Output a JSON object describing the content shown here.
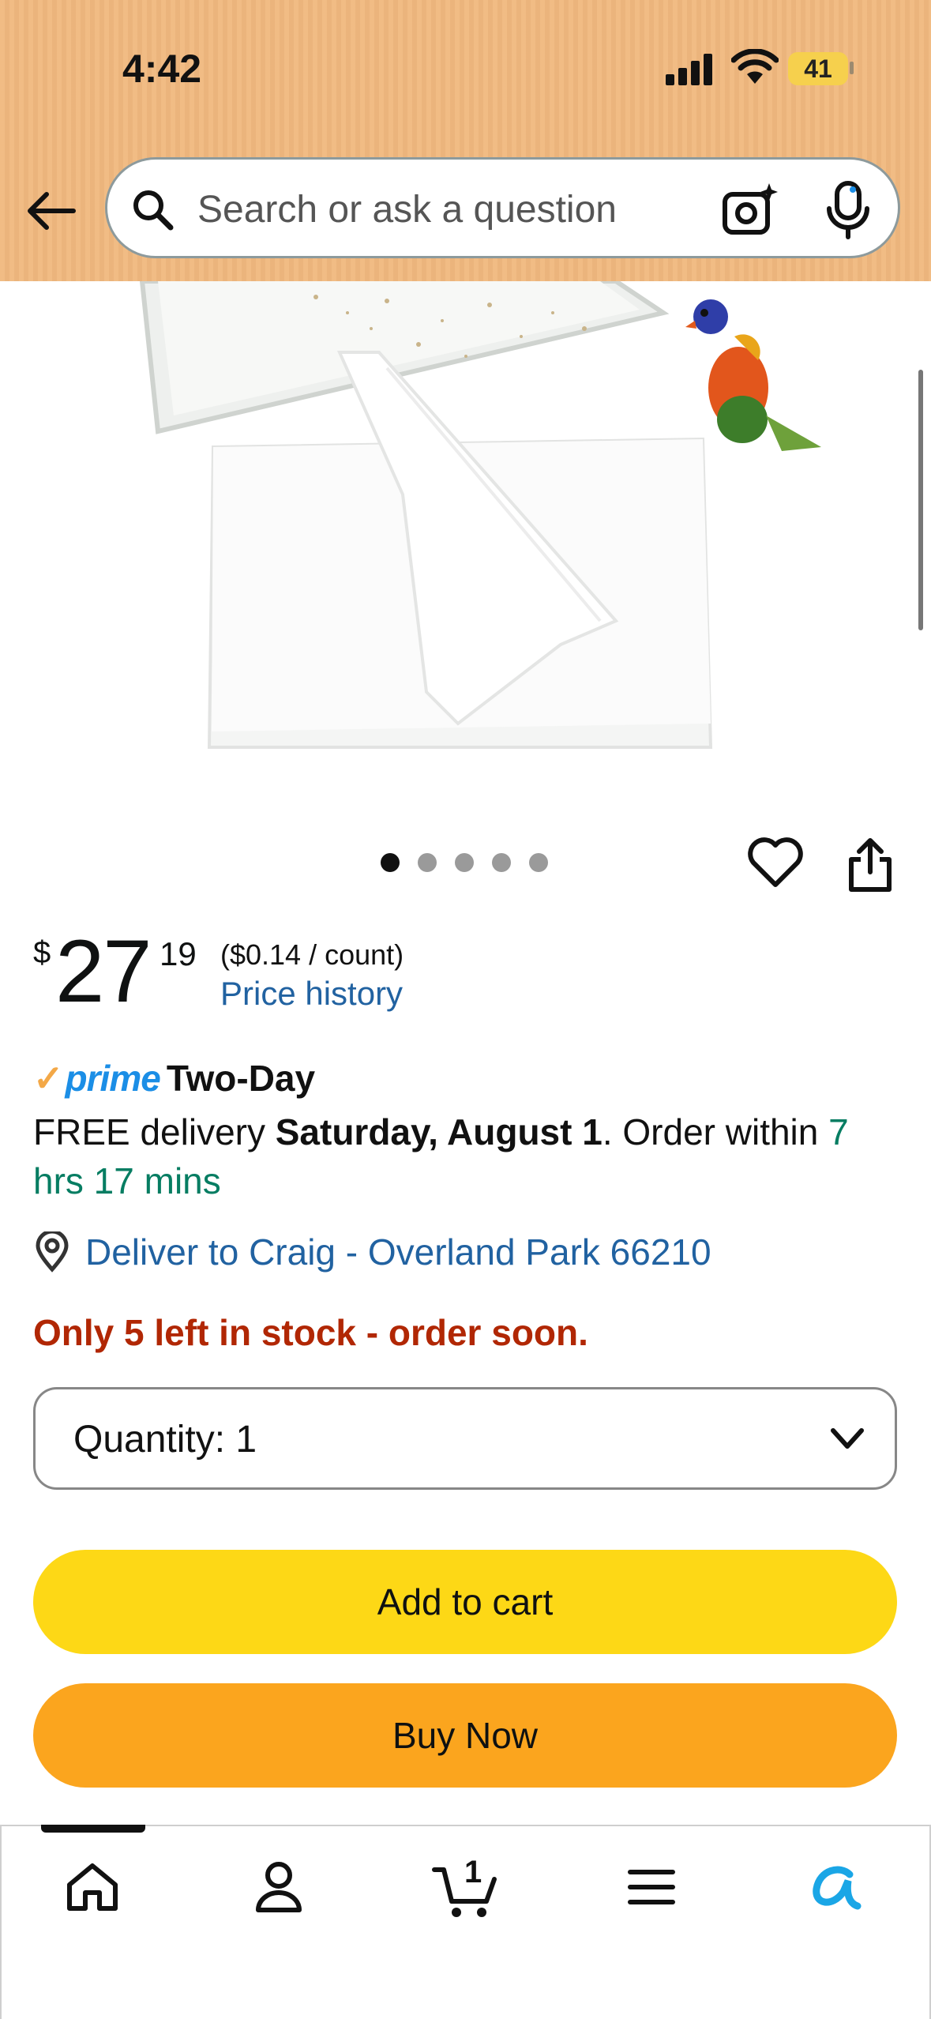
{
  "status_bar": {
    "time": "4:42",
    "battery": "41"
  },
  "search": {
    "placeholder": "Search or ask a question"
  },
  "product": {
    "image_alt": "White paper sheets with parrot",
    "image_count": 5,
    "active_image": 1
  },
  "price": {
    "currency": "$",
    "whole": "27",
    "fraction": "19",
    "unit_price": "($0.14 / count)",
    "history_link": "Price history"
  },
  "prime": {
    "check": "✓",
    "word": "prime",
    "label": "Two-Day"
  },
  "delivery": {
    "prefix": "FREE delivery ",
    "date": "Saturday, August 1",
    "middle": ". Order within ",
    "countdown": "7 hrs 17 mins"
  },
  "location": {
    "text": "Deliver to Craig - Overland Park 66210"
  },
  "stock": {
    "text": "Only 5 left in stock - order soon."
  },
  "quantity": {
    "label": "Quantity:  1"
  },
  "buttons": {
    "add_to_cart": "Add to cart",
    "buy_now": "Buy Now"
  },
  "nav": {
    "cart_count": "1"
  },
  "colors": {
    "header": "#f0b87e",
    "link": "#2162a1",
    "prime_blue": "#1b8ee6",
    "stock_red": "#b12704",
    "countdown_green": "#067d62",
    "add_to_cart": "#fdd816",
    "buy_now": "#fba51e"
  }
}
